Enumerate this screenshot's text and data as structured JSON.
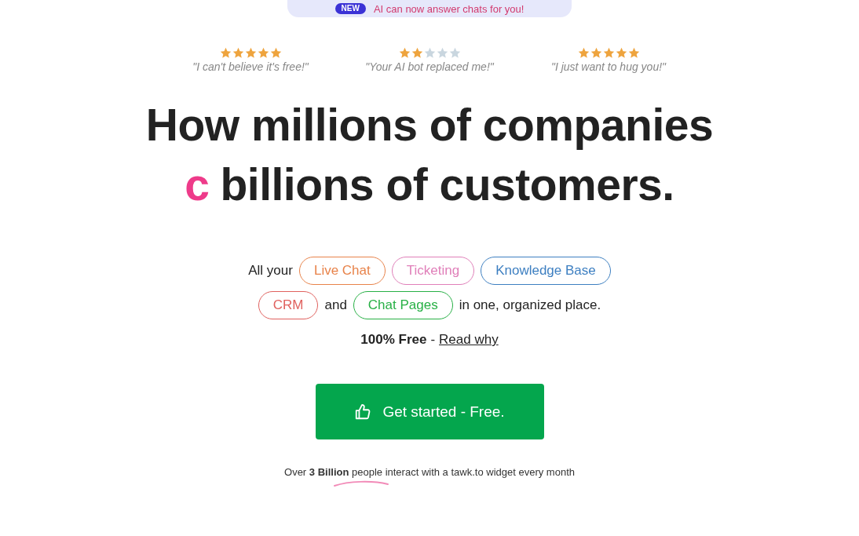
{
  "banner": {
    "badge": "NEW",
    "text": "AI can now answer chats for you!"
  },
  "reviews": [
    {
      "stars": 5,
      "quote": "\"I can't believe it's free!\""
    },
    {
      "stars": 2,
      "quote": "\"Your AI bot replaced me!\""
    },
    {
      "stars": 5,
      "quote": "\"I just want to hug you!\""
    }
  ],
  "headline": {
    "line1": "How millions of companies",
    "typed": "c",
    "line2": "billions of customers."
  },
  "products": {
    "lead": "All your",
    "tags": [
      {
        "label": "Live Chat",
        "color": "#e8834a"
      },
      {
        "label": "Ticketing",
        "color": "#e07fb9"
      },
      {
        "label": "Knowledge Base",
        "color": "#3d7fc1"
      },
      {
        "label": "CRM",
        "color": "#e0615e"
      },
      {
        "label": "Chat Pages",
        "color": "#27b045"
      }
    ],
    "joiner": "and",
    "tail": "in one, organized place."
  },
  "free": {
    "text": "100% Free",
    "separator": "-",
    "link": "Read why"
  },
  "cta": {
    "label": "Get started - Free."
  },
  "stat": {
    "text": "Over **3 Billion** people interact with a tawk.to widget every month"
  }
}
